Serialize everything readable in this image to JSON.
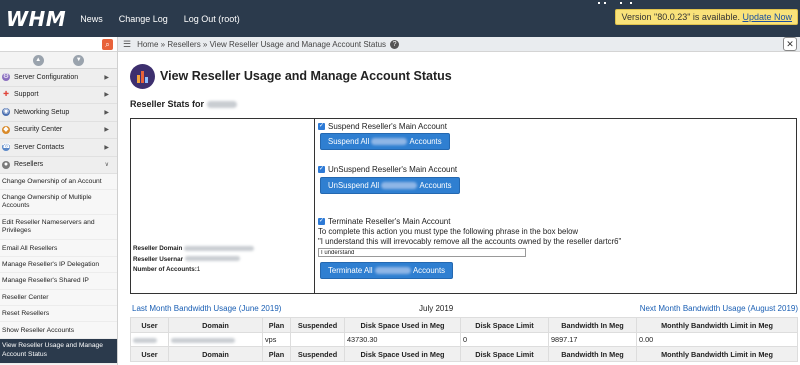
{
  "topbar": {
    "logo": "WHM",
    "nav": [
      "News",
      "Change Log",
      "Log Out (root)"
    ],
    "update_text": "Version \"80.0.23\" is available.",
    "update_link": "Update Now"
  },
  "sidebar": {
    "categories": [
      {
        "label": "Server Configuration",
        "icon": "gear-icon",
        "color": "#8a6fbf"
      },
      {
        "label": "Support",
        "icon": "lifebuoy-icon",
        "color": "#e0443a"
      },
      {
        "label": "Networking Setup",
        "icon": "network-icon",
        "color": "#4a6fb0"
      },
      {
        "label": "Security Center",
        "icon": "shield-icon",
        "color": "#d98a2a"
      },
      {
        "label": "Server Contacts",
        "icon": "contacts-icon",
        "color": "#5a88c8"
      },
      {
        "label": "Resellers",
        "icon": "resellers-icon",
        "color": "#7a7a7a"
      }
    ],
    "items": [
      "Change Ownership of an Account",
      "Change Ownership of Multiple Accounts",
      "Edit Reseller Nameservers and Privileges",
      "Email All Resellers",
      "Manage Reseller's IP Delegation",
      "Manage Reseller's Shared IP",
      "Reseller Center",
      "Reset Resellers",
      "Show Reseller Accounts",
      "View Reseller Usage and Manage Account Status"
    ]
  },
  "breadcrumb": {
    "home": "Home",
    "sep": "»",
    "resellers": "Resellers",
    "current": "View Reseller Usage and Manage Account Status"
  },
  "page": {
    "title": "View Reseller Usage and Manage Account Status",
    "stats_label": "Reseller Stats for"
  },
  "stats": {
    "domain_label": "Reseller Domain",
    "username_label": "Reseller Usernar",
    "accounts_label": "Number of Accounts:",
    "accounts_value": "1"
  },
  "actions": {
    "suspend_label": "Suspend Reseller's Main Account",
    "suspend_btn_pre": "Suspend All",
    "suspend_btn_post": "Accounts",
    "unsuspend_label": "UnSuspend Reseller's Main Account",
    "unsuspend_btn_pre": "UnSuspend All",
    "unsuspend_btn_post": "Accounts",
    "terminate_label": "Terminate Reseller's Main Account",
    "instr1": "To complete this action you must type the following phrase in the box below",
    "instr2": "\"I understand this will irrevocably remove all the accounts owned by the reseller dartcr6\"",
    "input_value": "I understand",
    "terminate_btn_pre": "Terminate All",
    "terminate_btn_post": "Accounts"
  },
  "months": {
    "prev": "Last Month Bandwidth Usage (June 2019)",
    "current": "July 2019",
    "next": "Next Month Bandwidth Usage (August 2019)"
  },
  "table": {
    "headers": [
      "User",
      "Domain",
      "Plan",
      "Suspended",
      "Disk Space Used in Meg",
      "Disk Space Limit",
      "Bandwidth In Meg",
      "Monthly Bandwidth Limit in Meg"
    ],
    "row": {
      "plan": "vps",
      "disk_used": "43730.30",
      "disk_limit": "0",
      "bandwidth": "9897.17",
      "bw_limit": "0.00"
    }
  }
}
